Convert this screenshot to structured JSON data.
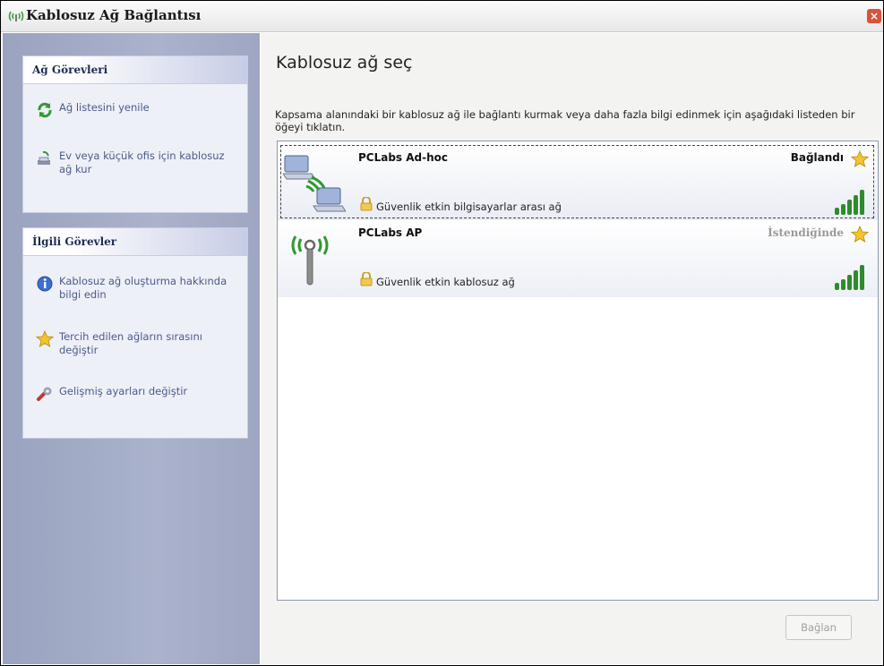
{
  "window": {
    "title": "Kablosuz Ağ Bağlantısı",
    "close_label": "×"
  },
  "sidebar": {
    "network_tasks": {
      "title": "Ağ Görevleri",
      "items": [
        {
          "label": "Ağ listesini yenile",
          "icon": "refresh-icon"
        },
        {
          "label": "Ev veya küçük ofis için kablosuz ağ kur",
          "icon": "setup-network-icon"
        }
      ]
    },
    "related_tasks": {
      "title": "İlgili Görevler",
      "items": [
        {
          "label": "Kablosuz ağ oluşturma hakkında bilgi edin",
          "icon": "info-icon"
        },
        {
          "label": "Tercih edilen ağların sırasını değiştir",
          "icon": "star-icon"
        },
        {
          "label": "Gelişmiş ayarları değiştir",
          "icon": "advanced-settings-icon"
        }
      ]
    }
  },
  "main": {
    "title": "Kablosuz ağ seç",
    "description": "Kapsama alanındaki bir kablosuz ağ ile bağlantı kurmak veya daha fazla bilgi edinmek için aşağıdaki listeden bir öğeyi tıklatın.",
    "networks": [
      {
        "name": "PCLabs Ad-hoc",
        "status": "Bağlandı",
        "security": "Güvenlik etkin bilgisayarlar arası ağ",
        "signal_bars": 5,
        "icon": "ad-hoc-network-icon"
      },
      {
        "name": "PCLabs AP",
        "status": "İstendiğinde",
        "security": "Güvenlik etkin kablosuz ağ",
        "signal_bars": 5,
        "icon": "access-point-icon"
      }
    ],
    "connect_button": "Bağlan"
  },
  "colors": {
    "sidebar_bg": "#9aa3bf",
    "panel_bg": "#eef0f8",
    "signal_green": "#2e8b2e",
    "task_text": "#4b5a87"
  }
}
